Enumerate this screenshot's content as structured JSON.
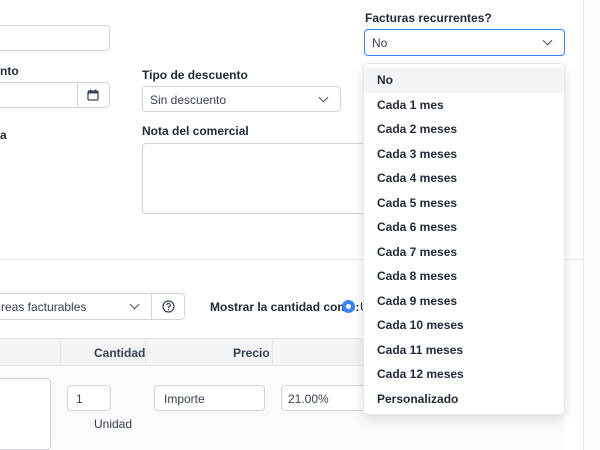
{
  "top_field": {
    "value": ""
  },
  "date_field": {
    "label_fragment": "nto",
    "value": ""
  },
  "discount": {
    "label": "Tipo de descuento",
    "value": "Sin descuento"
  },
  "left_label_fragment": "a",
  "merchant_note": {
    "label": "Nota del comercial",
    "value": ""
  },
  "recurring": {
    "label": "Facturas recurrentes?",
    "value": "No",
    "options": [
      "No",
      "Cada 1 mes",
      "Cada 2 meses",
      "Cada 3 meses",
      "Cada 4 meses",
      "Cada 5 meses",
      "Cada 6 meses",
      "Cada 7 meses",
      "Cada 8 meses",
      "Cada 9 meses",
      "Cada 10 meses",
      "Cada 11 meses",
      "Cada 12 meses",
      "Personalizado"
    ],
    "selected_index": 0
  },
  "billable": {
    "placeholder": "reas facturables",
    "help_icon": "question-circle-icon"
  },
  "quantity_display": {
    "label": "Mostrar la cantidad como:",
    "option_fragment": "U"
  },
  "table": {
    "headers": {
      "quantity": "Cantidad",
      "price": "Precio"
    },
    "row": {
      "quantity": "1",
      "unit": "Unidad",
      "price_placeholder": "Importe",
      "tax": "21.00%"
    }
  },
  "colors": {
    "accent": "#3b82f6",
    "border": "#d1d5db",
    "header_bg": "#f3f4f6"
  }
}
